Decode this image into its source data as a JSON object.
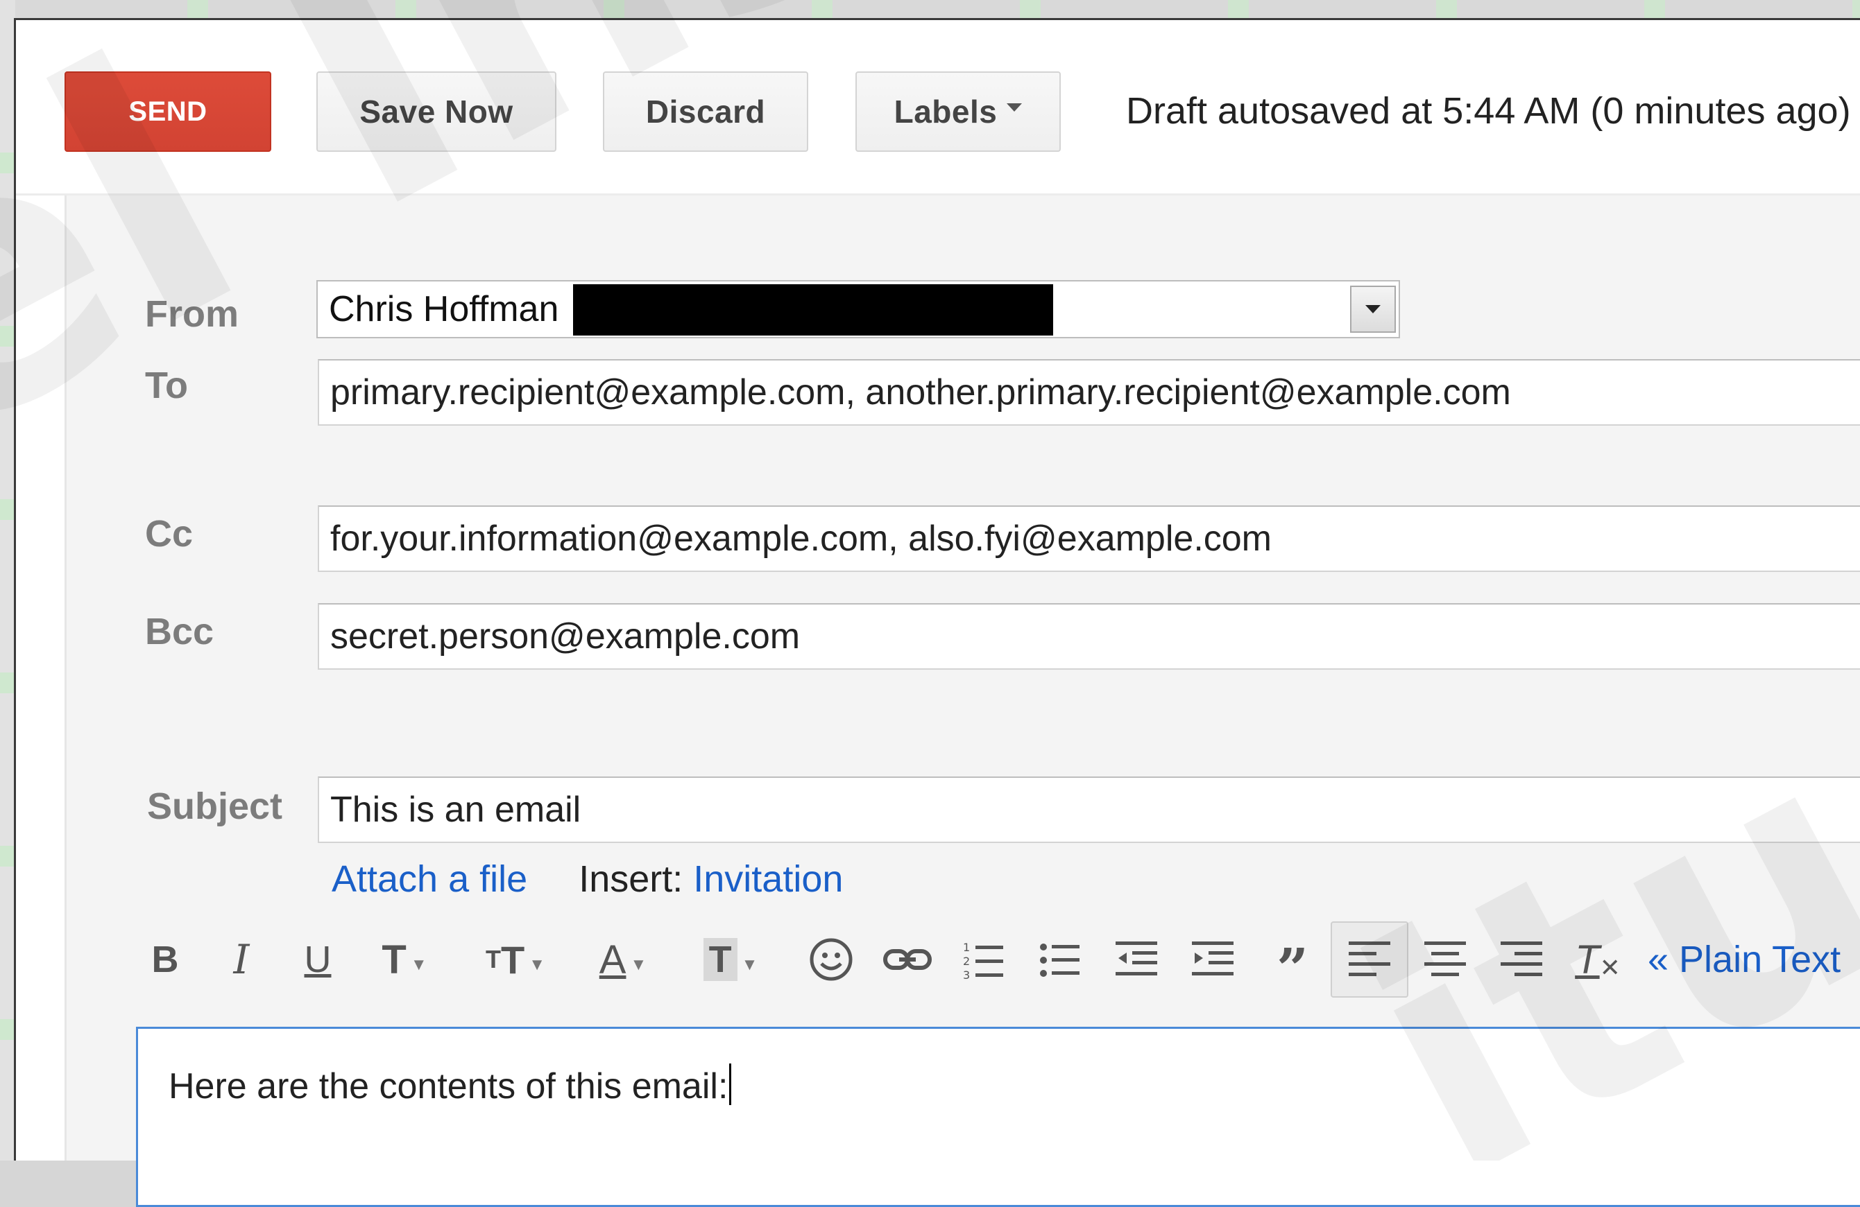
{
  "toolbar": {
    "send_label": "SEND",
    "save_label": "Save Now",
    "discard_label": "Discard",
    "labels_label": "Labels",
    "autosave_status": "Draft autosaved at 5:44 AM (0 minutes ago)"
  },
  "compose": {
    "from": {
      "label": "From",
      "value": "Chris Hoffman"
    },
    "to": {
      "label": "To",
      "value": "primary.recipient@example.com, another.primary.recipient@example.com"
    },
    "cc": {
      "label": "Cc",
      "value": "for.your.information@example.com, also.fyi@example.com"
    },
    "bcc": {
      "label": "Bcc",
      "value": "secret.person@example.com"
    },
    "subject": {
      "label": "Subject",
      "value": "This is an email"
    },
    "attach_label": "Attach a file",
    "insert_label": "Insert:",
    "invitation_label": "Invitation"
  },
  "formatting": {
    "icons": [
      "bold-icon",
      "italic-icon",
      "underline-icon",
      "font-icon",
      "font-size-icon",
      "text-color-icon",
      "highlight-icon",
      "emoji-icon",
      "link-icon",
      "numbered-list-icon",
      "bulleted-list-icon",
      "indent-less-icon",
      "indent-more-icon",
      "quote-icon",
      "align-left-icon",
      "align-center-icon",
      "align-right-icon",
      "remove-formatting-icon"
    ],
    "plain_text_label": "« Plain Text"
  },
  "body": {
    "text": "Here are the contents of this email:"
  },
  "colors": {
    "send_button": "#dd4b39",
    "link": "#1a5fc8",
    "editor_focus_border": "#4a8ad8",
    "compose_background": "#f4f4f4"
  },
  "watermark": {
    "text_main": "el Institute",
    "text_corner": "itu"
  }
}
